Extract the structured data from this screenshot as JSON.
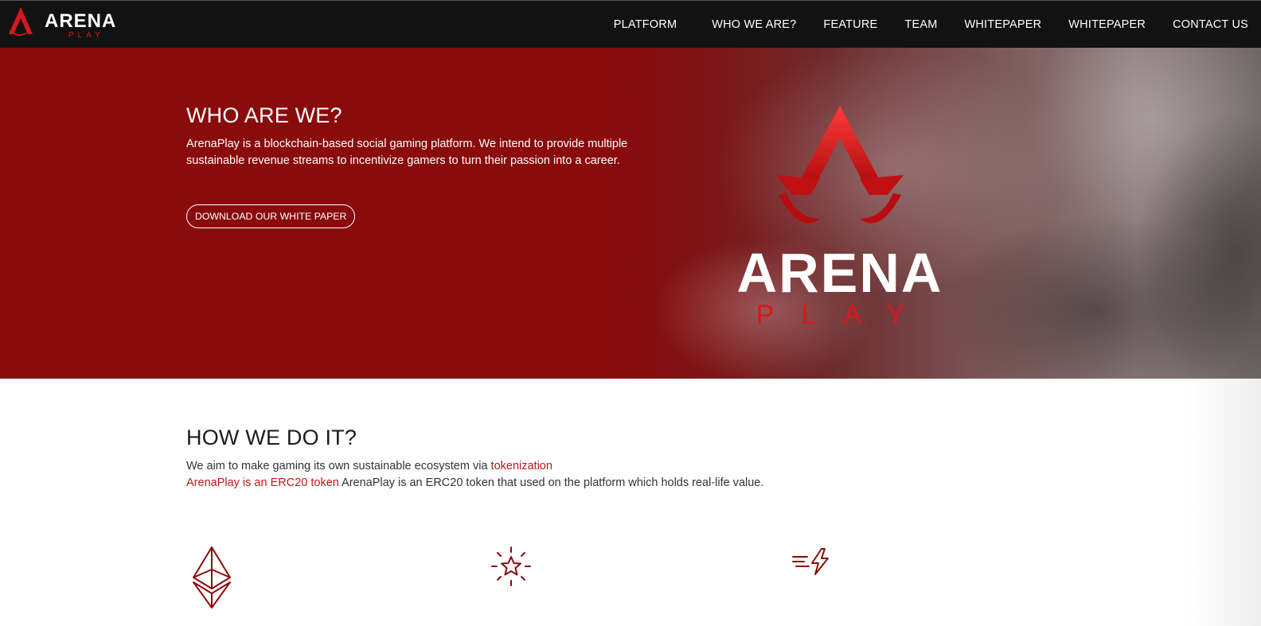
{
  "brand": {
    "name": "ARENA",
    "sub": "PLAY",
    "color": "#c0181b"
  },
  "nav": [
    {
      "label": "PLATFORM"
    },
    {
      "label": "WHO WE ARE?"
    },
    {
      "label": "FEATURE"
    },
    {
      "label": "TEAM"
    },
    {
      "label": "WHITEPAPER"
    },
    {
      "label": "WHITEPAPER"
    },
    {
      "label": "CONTACT US"
    }
  ],
  "hero": {
    "title": "WHO ARE WE?",
    "text": "ArenaPlay is a blockchain-based social gaming platform. We intend to provide multiple sustainable revenue streams to incentivize gamers to turn their passion into a career.",
    "button": "DOWNLOAD OUR WHITE PAPER",
    "logo_word": "ARENA",
    "logo_sub": "PLAY"
  },
  "how": {
    "title": "HOW WE DO IT?",
    "line1_text": "We aim to make gaming its own sustainable ecosystem via ",
    "line1_link": "tokenization",
    "line2_link": "ArenaPlay is an ERC20 token",
    "line2_text": " ArenaPlay is an ERC20 token that used on the platform which holds real-life value."
  },
  "features": [
    {
      "icon": "ethereum-icon"
    },
    {
      "icon": "star-burst-icon"
    },
    {
      "icon": "fast-lightning-icon"
    }
  ]
}
